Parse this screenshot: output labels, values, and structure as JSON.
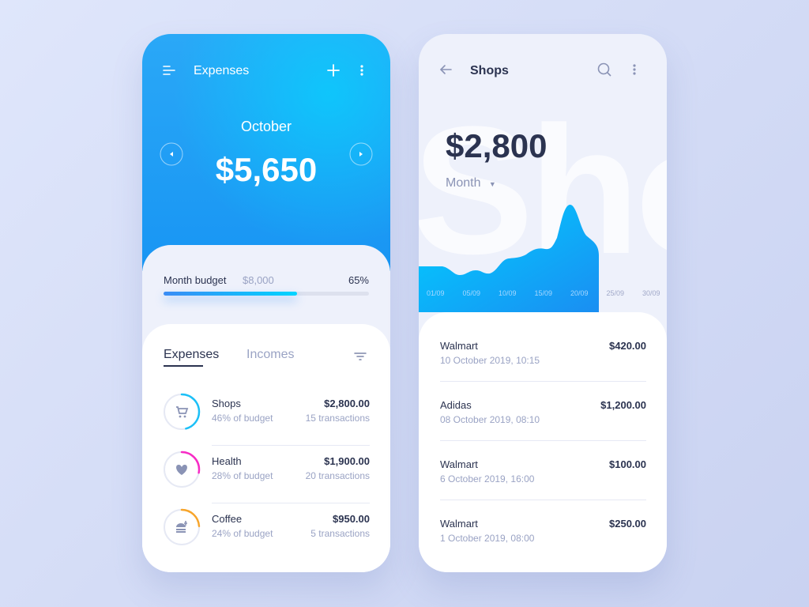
{
  "expenses_screen": {
    "title": "Expenses",
    "month": "October",
    "total": "$5,650",
    "budget": {
      "label": "Month budget",
      "amount": "$8,000",
      "percent_label": "65%",
      "progress": 0.65
    },
    "tabs": [
      {
        "label": "Expenses",
        "active": true
      },
      {
        "label": "Incomes",
        "active": false
      }
    ],
    "categories": [
      {
        "name": "Shops",
        "budget_share": "46% of budget",
        "amount": "$2,800.00",
        "transactions": "15 transactions",
        "icon": "cart-icon",
        "color": "#1cc0f7",
        "fraction": 0.46
      },
      {
        "name": "Health",
        "budget_share": "28% of budget",
        "amount": "$1,900.00",
        "transactions": "20 transactions",
        "icon": "heart-icon",
        "color": "#f72bc5",
        "fraction": 0.28
      },
      {
        "name": "Coffee",
        "budget_share": "24% of budget",
        "amount": "$950.00",
        "transactions": "5 transactions",
        "icon": "food-icon",
        "color": "#f7a52b",
        "fraction": 0.24
      }
    ]
  },
  "shops_screen": {
    "title": "Shops",
    "watermark": "Shops",
    "total": "$2,800",
    "period": "Month",
    "chart_ticks": [
      "01/09",
      "05/09",
      "10/09",
      "15/09",
      "20/09",
      "25/09",
      "30/09"
    ],
    "transactions": [
      {
        "merchant": "Walmart",
        "date": "10 October 2019, 10:15",
        "amount": "$420.00"
      },
      {
        "merchant": "Adidas",
        "date": "08 October 2019, 08:10",
        "amount": "$1,200.00"
      },
      {
        "merchant": "Walmart",
        "date": "6 October 2019, 16:00",
        "amount": "$100.00"
      },
      {
        "merchant": "Walmart",
        "date": "1 October 2019,  08:00",
        "amount": "$250.00"
      }
    ]
  }
}
